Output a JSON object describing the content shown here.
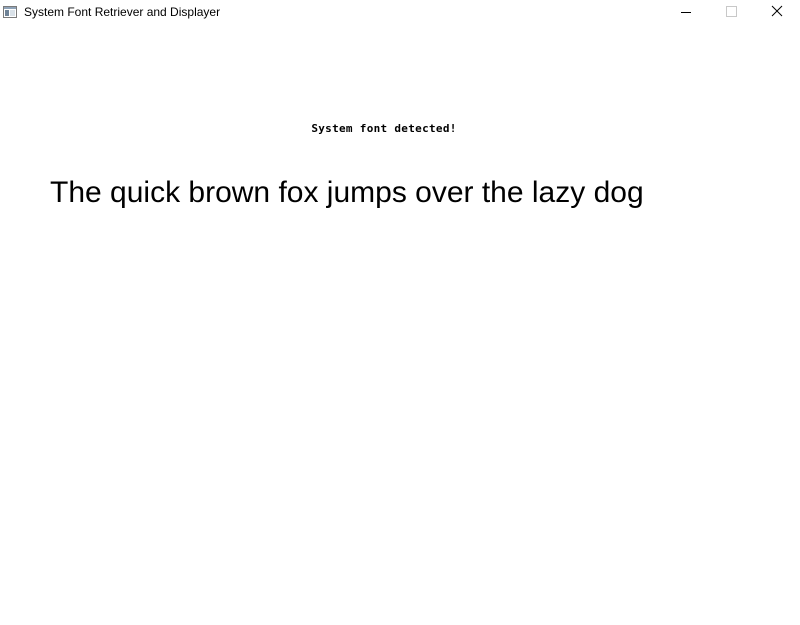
{
  "window": {
    "title": "System Font Retriever and Displayer",
    "app_icon": "app-window-icon",
    "controls": {
      "minimize_icon": "minimize-icon",
      "maximize_icon": "maximize-icon",
      "close_icon": "close-icon"
    }
  },
  "content": {
    "status_message": "System font detected!",
    "sample_text": "The quick brown fox jumps over the lazy dog"
  }
}
